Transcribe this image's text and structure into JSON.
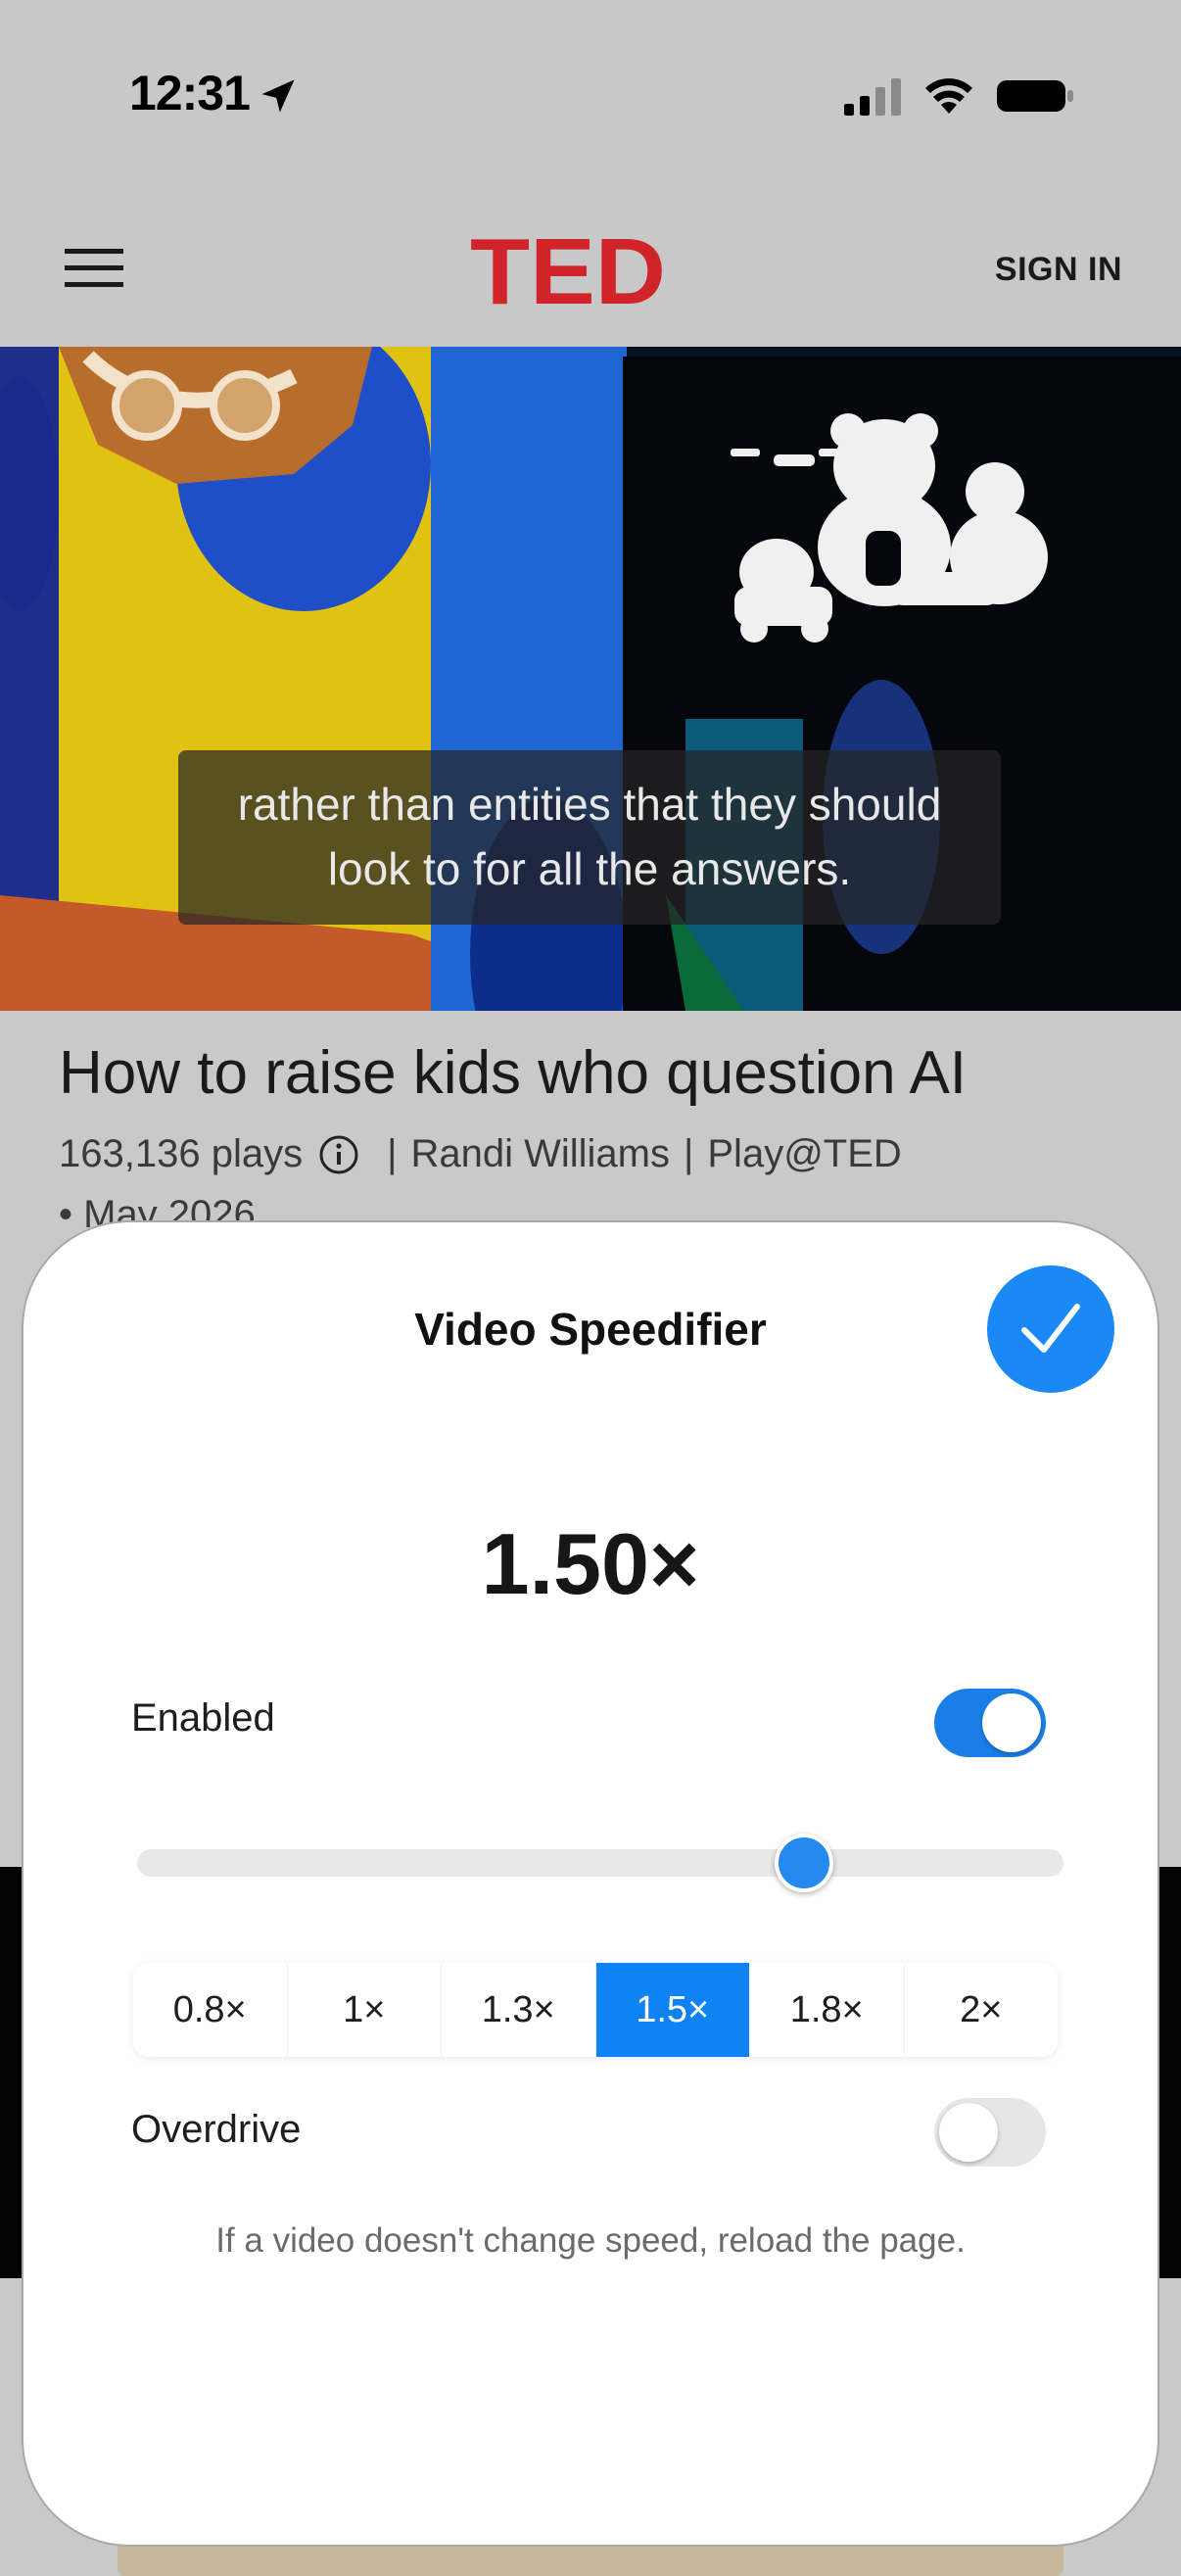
{
  "status_bar": {
    "time": "12:31",
    "icons": [
      "location-arrow-icon",
      "cellular-signal-icon",
      "wifi-icon",
      "battery-icon"
    ]
  },
  "header": {
    "menu_icon": "hamburger-menu-icon",
    "logo_text": "TED",
    "sign_in_label": "SIGN IN",
    "logo_color": "#e62b1e"
  },
  "video": {
    "caption_line1": "rather than entities that they should",
    "caption_line2": "look to for all the answers."
  },
  "talk": {
    "title": "How to raise kids who question AI",
    "plays": "163,136 plays",
    "separator": "|",
    "speaker": "Randi Williams",
    "event": "Play@TED",
    "date": "• May 2026"
  },
  "sheet": {
    "title": "Video Speedifier",
    "done_icon": "checkmark-icon",
    "speed_display": "1.50×",
    "enabled_label": "Enabled",
    "enabled": true,
    "slider_fraction": 0.72,
    "presets": [
      "0.8×",
      "1×",
      "1.3×",
      "1.5×",
      "1.8×",
      "2×"
    ],
    "active_preset": "1.5×",
    "overdrive_label": "Overdrive",
    "overdrive": false,
    "hint": "If a video doesn't change speed, reload the page.",
    "accent_color": "#0f82f6"
  }
}
